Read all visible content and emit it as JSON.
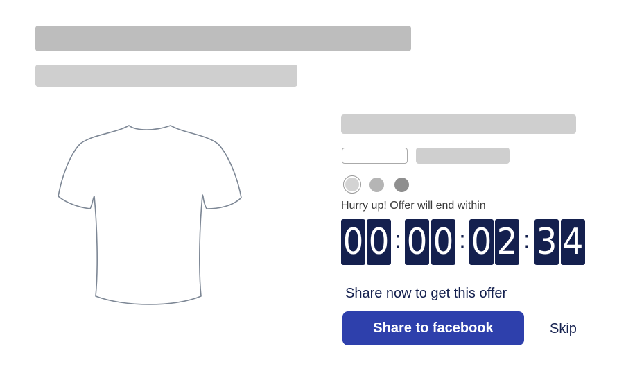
{
  "product": {
    "image_icon": "tshirt-icon",
    "colors": [
      "#d3d3d3",
      "#b5b5b5",
      "#8f8f8f"
    ]
  },
  "offer": {
    "text": "Hurry up! Offer will end within",
    "timer": {
      "digits": [
        "0",
        "0",
        "0",
        "0",
        "0",
        "2",
        "3",
        "4"
      ],
      "separator": ":"
    }
  },
  "share": {
    "title": "Share now to get this offer",
    "button_label": "Share to facebook",
    "skip_label": "Skip",
    "accent": "#2e40ac",
    "dark": "#14204e"
  }
}
